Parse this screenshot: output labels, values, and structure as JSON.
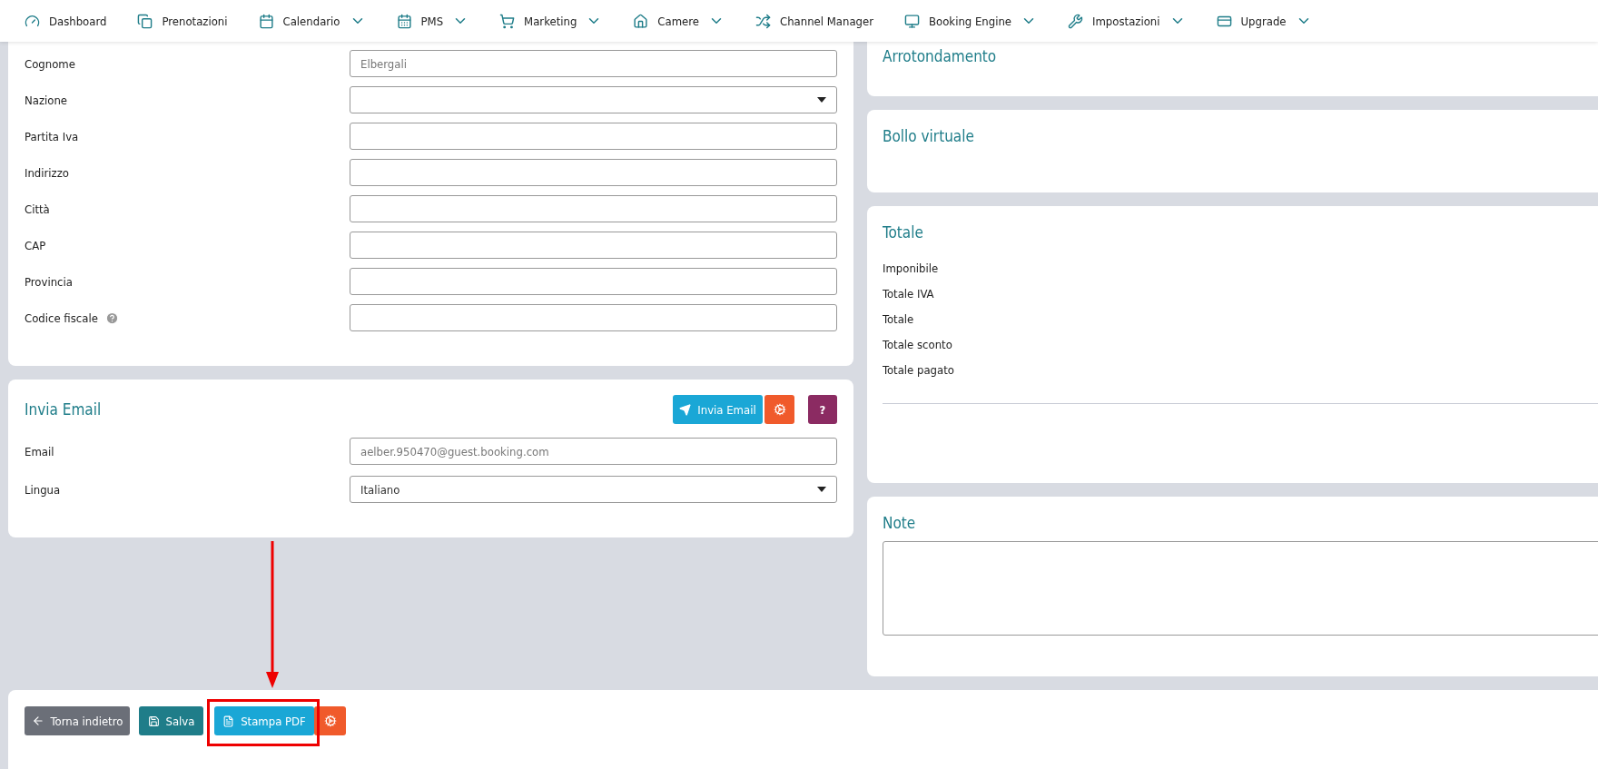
{
  "nav": [
    {
      "label": "Dashboard",
      "dropdown": false
    },
    {
      "label": "Prenotazioni",
      "dropdown": false
    },
    {
      "label": "Calendario",
      "dropdown": true
    },
    {
      "label": "PMS",
      "dropdown": true
    },
    {
      "label": "Marketing",
      "dropdown": true
    },
    {
      "label": "Camere",
      "dropdown": true
    },
    {
      "label": "Channel Manager",
      "dropdown": false
    },
    {
      "label": "Booking Engine",
      "dropdown": true
    },
    {
      "label": "Impostazioni",
      "dropdown": true
    },
    {
      "label": "Upgrade",
      "dropdown": true
    }
  ],
  "customer_fields": [
    {
      "label": "Cognome",
      "kind": "text",
      "value": "Elbergali",
      "help": false
    },
    {
      "label": "Nazione",
      "kind": "select",
      "help": false
    },
    {
      "label": "Partita Iva",
      "kind": "text",
      "help": false
    },
    {
      "label": "Indirizzo",
      "kind": "text",
      "help": false
    },
    {
      "label": "Città",
      "kind": "text",
      "help": false
    },
    {
      "label": "CAP",
      "kind": "text",
      "help": false
    },
    {
      "label": "Provincia",
      "kind": "text",
      "help": false
    },
    {
      "label": "Codice fiscale",
      "kind": "text",
      "help": true
    }
  ],
  "email_panel": {
    "title": "Invia Email",
    "send_button": "Invia Email",
    "help_button": "?",
    "fields": [
      {
        "label": "Email",
        "kind": "text",
        "value": "aelber.950470@guest.booking.com",
        "help": false
      },
      {
        "label": "Lingua",
        "kind": "select",
        "value": "Italiano",
        "help": false
      }
    ]
  },
  "rounding_panel": {
    "title": "Arrotondamento"
  },
  "stamp_panel": {
    "title": "Bollo virtuale"
  },
  "totals_panel": {
    "title": "Totale",
    "rows": [
      "Imponibile",
      "Totale IVA",
      "Totale",
      "Totale sconto",
      "Totale pagato"
    ]
  },
  "notes_panel": {
    "title": "Note"
  },
  "actions": {
    "back": "Torna indietro",
    "save": "Salva",
    "print": "Stampa PDF"
  }
}
